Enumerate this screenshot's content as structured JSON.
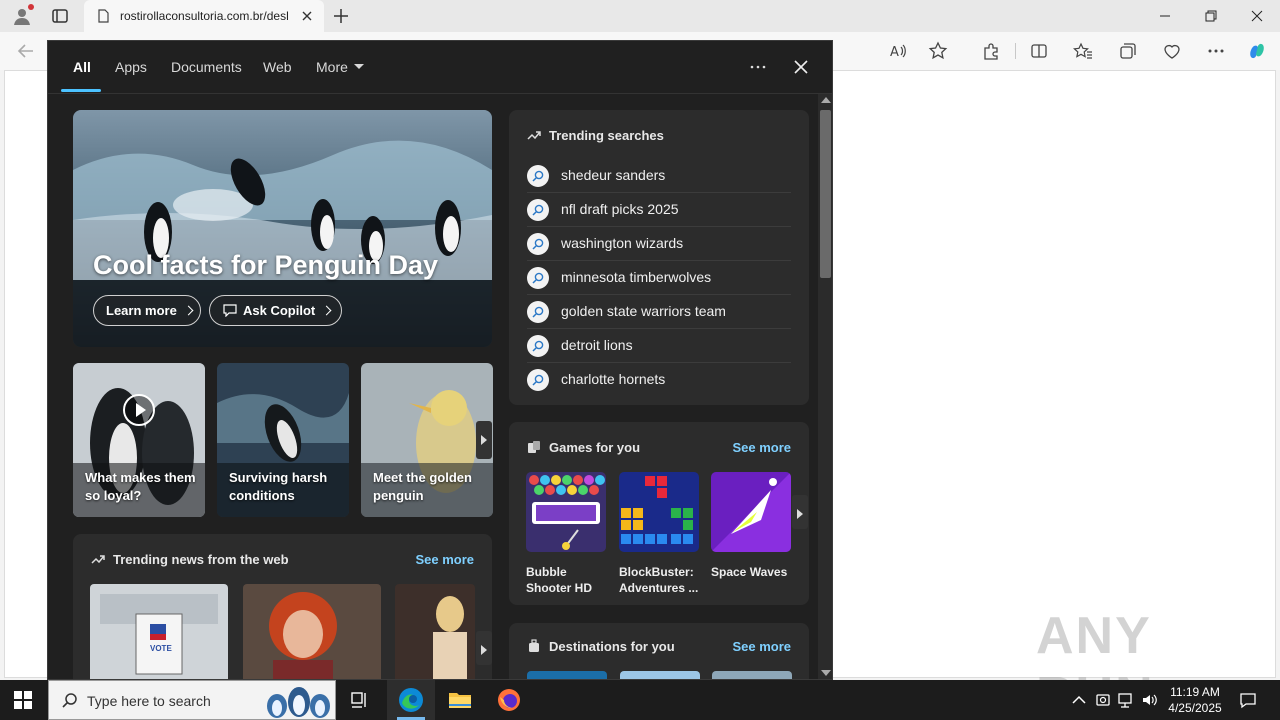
{
  "browser": {
    "tab_title": "rostirollaconsultoria.com.br/desl",
    "window_controls": [
      "minimize-icon",
      "restore-icon",
      "close-icon"
    ]
  },
  "flyout": {
    "tabs": [
      {
        "label": "All",
        "active": true
      },
      {
        "label": "Apps",
        "active": false
      },
      {
        "label": "Documents",
        "active": false
      },
      {
        "label": "Web",
        "active": false
      },
      {
        "label": "More",
        "active": false
      }
    ],
    "hero": {
      "title": "Cool facts for Penguin Day",
      "learn_more": "Learn more",
      "ask_copilot": "Ask Copilot"
    },
    "cards": [
      {
        "label": "What makes them so loyal?",
        "video": true
      },
      {
        "label": "Surviving harsh conditions",
        "video": false
      },
      {
        "label": "Meet the golden penguin",
        "video": false
      }
    ],
    "trending": {
      "title": "Trending searches",
      "items": [
        "shedeur sanders",
        "nfl draft picks 2025",
        "washington wizards",
        "minnesota timberwolves",
        "golden state warriors team",
        "detroit lions",
        "charlotte hornets"
      ]
    },
    "games": {
      "title": "Games for you",
      "see_more": "See more",
      "items": [
        {
          "name1": "Bubble",
          "name2": "Shooter HD"
        },
        {
          "name1": "BlockBuster:",
          "name2": "Adventures ..."
        },
        {
          "name1": "Space Waves",
          "name2": ""
        }
      ]
    },
    "news": {
      "title": "Trending news from the web",
      "see_more": "See more",
      "thumb_text": "VOTE"
    },
    "destinations": {
      "title": "Destinations for you",
      "see_more": "See more"
    }
  },
  "taskbar": {
    "search_placeholder": "Type here to search",
    "time": "11:19 AM",
    "date": "4/25/2025"
  },
  "watermark": "ANY RUN",
  "colors": {
    "accent": "#4cc2ff",
    "link": "#7fd0ff",
    "flyout_bg": "#202020",
    "panel_bg": "#2c2c2c"
  }
}
